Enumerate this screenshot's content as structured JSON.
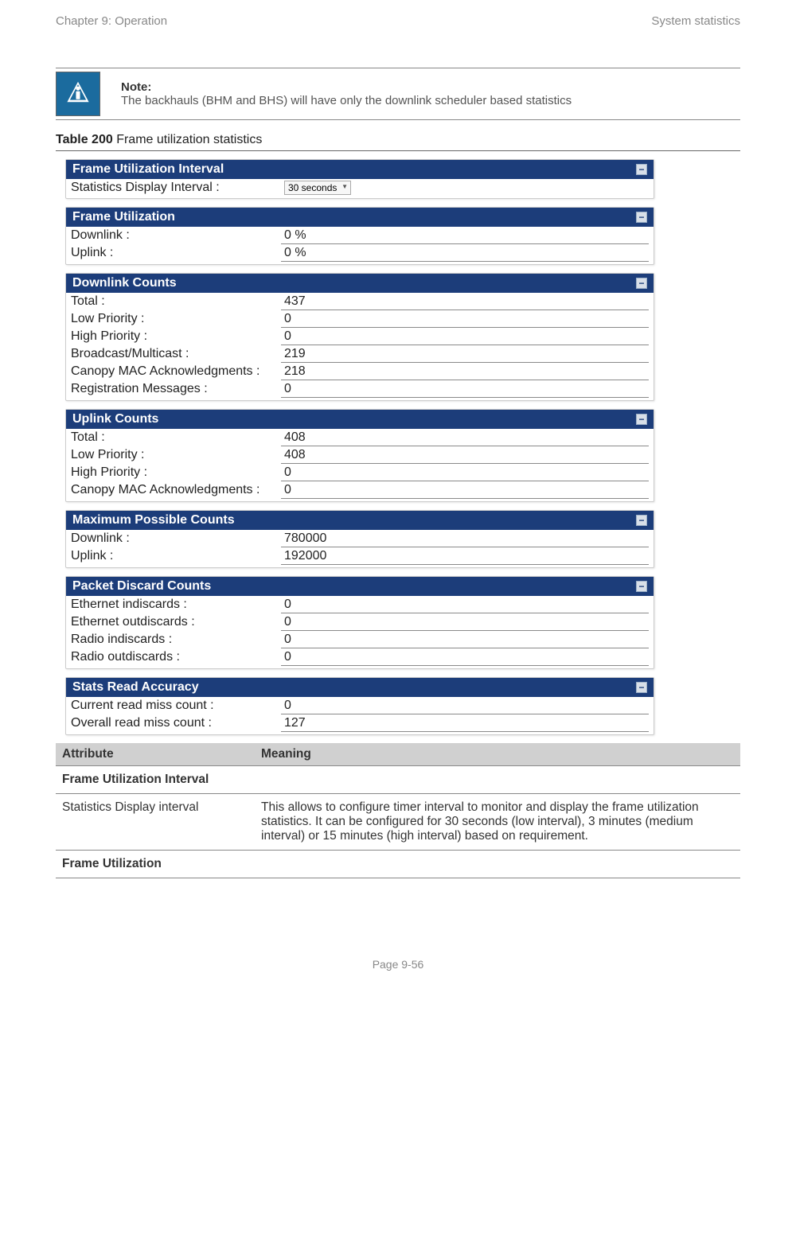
{
  "header": {
    "left": "Chapter 9:  Operation",
    "right": "System statistics"
  },
  "note": {
    "label": "Note:",
    "text": "The backhauls (BHM and BHS) will have only the downlink scheduler based statistics"
  },
  "tableCaption": {
    "num": "Table 200",
    "title": " Frame utilization statistics"
  },
  "panels": [
    {
      "title": "Frame Utilization Interval",
      "rows": [
        {
          "label": "Statistics Display Interval :",
          "value": "30 seconds",
          "type": "select"
        }
      ]
    },
    {
      "title": "Frame Utilization",
      "rows": [
        {
          "label": "Downlink :",
          "value": "0 %"
        },
        {
          "label": "Uplink :",
          "value": "0 %"
        }
      ]
    },
    {
      "title": "Downlink Counts",
      "rows": [
        {
          "label": "Total :",
          "value": "437"
        },
        {
          "label": "Low Priority :",
          "value": "0"
        },
        {
          "label": "High Priority :",
          "value": "0"
        },
        {
          "label": "Broadcast/Multicast :",
          "value": "219"
        },
        {
          "label": "Canopy MAC Acknowledgments :",
          "value": "218"
        },
        {
          "label": "Registration Messages :",
          "value": "0"
        }
      ]
    },
    {
      "title": "Uplink Counts",
      "rows": [
        {
          "label": "Total :",
          "value": "408"
        },
        {
          "label": "Low Priority :",
          "value": "408"
        },
        {
          "label": "High Priority :",
          "value": "0"
        },
        {
          "label": "Canopy MAC Acknowledgments :",
          "value": "0"
        }
      ]
    },
    {
      "title": "Maximum Possible Counts",
      "rows": [
        {
          "label": "Downlink :",
          "value": "780000"
        },
        {
          "label": "Uplink :",
          "value": "192000"
        }
      ]
    },
    {
      "title": "Packet Discard Counts",
      "rows": [
        {
          "label": "Ethernet indiscards :",
          "value": "0"
        },
        {
          "label": "Ethernet outdiscards :",
          "value": "0"
        },
        {
          "label": "Radio indiscards :",
          "value": "0"
        },
        {
          "label": "Radio outdiscards :",
          "value": "0"
        }
      ]
    },
    {
      "title": "Stats Read Accuracy",
      "rows": [
        {
          "label": "Current read miss count :",
          "value": "0"
        },
        {
          "label": "Overall read miss count :",
          "value": "127"
        }
      ]
    }
  ],
  "attrTable": {
    "headers": [
      "Attribute",
      "Meaning"
    ],
    "rows": [
      {
        "section": true,
        "cells": [
          "Frame Utilization Interval",
          ""
        ]
      },
      {
        "cells": [
          "Statistics Display interval",
          "This allows to configure timer interval to monitor and display the frame utilization statistics. It can be configured for 30 seconds (low interval), 3 minutes (medium interval) or 15 minutes (high interval) based on requirement."
        ]
      },
      {
        "section": true,
        "cells": [
          "Frame Utilization",
          ""
        ]
      }
    ]
  },
  "footer": "Page 9-56"
}
